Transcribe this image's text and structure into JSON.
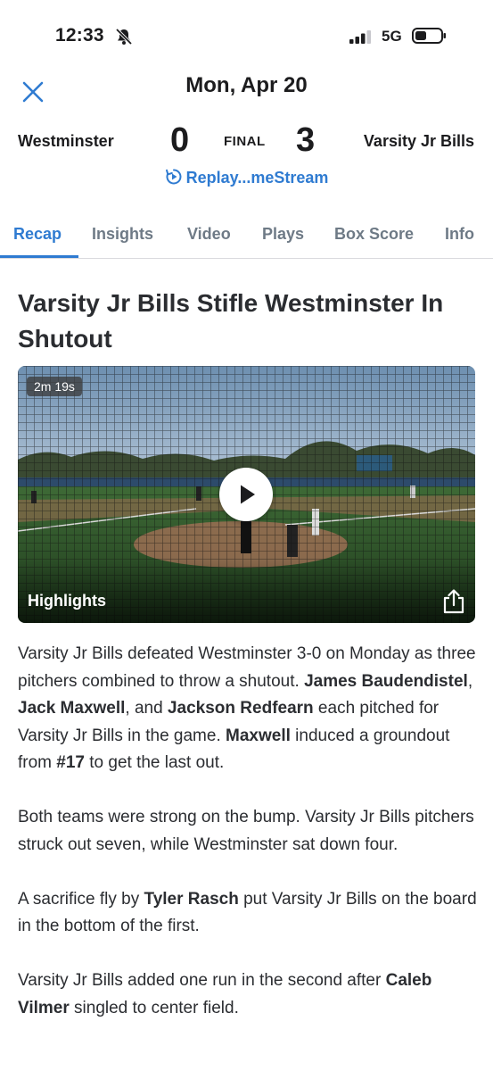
{
  "status_bar": {
    "time": "12:33",
    "network": "5G",
    "icons": [
      "bell-slash-icon",
      "signal-icon",
      "battery-icon"
    ]
  },
  "header": {
    "date_title": "Mon, Apr 20",
    "home_team": "Westminster",
    "away_team": "Varsity Jr Bills",
    "home_score": "0",
    "away_score": "3",
    "game_status": "FINAL",
    "replay_label": "Replay...meStream"
  },
  "tabs": [
    {
      "label": "Recap",
      "active": true
    },
    {
      "label": "Insights",
      "active": false
    },
    {
      "label": "Video",
      "active": false
    },
    {
      "label": "Plays",
      "active": false
    },
    {
      "label": "Box Score",
      "active": false
    },
    {
      "label": "Info",
      "active": false
    }
  ],
  "article": {
    "headline": "Varsity Jr Bills Stifle Westminster In Shutout",
    "video": {
      "duration": "2m 19s",
      "label": "Highlights"
    },
    "paragraphs": [
      [
        {
          "t": "Varsity Jr Bills defeated Westminster 3-0 on Monday as three pitchers combined to throw a shutout. ",
          "b": false
        },
        {
          "t": "James Baudendistel",
          "b": true
        },
        {
          "t": ", ",
          "b": false
        },
        {
          "t": "Jack Maxwell",
          "b": true
        },
        {
          "t": ", and ",
          "b": false
        },
        {
          "t": "Jackson Redfearn",
          "b": true
        },
        {
          "t": " each pitched for Varsity Jr Bills in the game. ",
          "b": false
        },
        {
          "t": "Maxwell",
          "b": true
        },
        {
          "t": " induced a groundout from ",
          "b": false
        },
        {
          "t": "#17",
          "b": true
        },
        {
          "t": " to get the last out.",
          "b": false
        }
      ],
      [
        {
          "t": "Both teams were strong on the bump. Varsity Jr Bills pitchers struck out seven, while Westminster sat down four.",
          "b": false
        }
      ],
      [
        {
          "t": "A sacrifice fly by ",
          "b": false
        },
        {
          "t": "Tyler Rasch",
          "b": true
        },
        {
          "t": " put Varsity Jr Bills on the board in the bottom of the first.",
          "b": false
        }
      ],
      [
        {
          "t": "Varsity Jr Bills added one run in the second after ",
          "b": false
        },
        {
          "t": "Caleb Vilmer",
          "b": true
        },
        {
          "t": " singled to center field.",
          "b": false
        }
      ]
    ]
  },
  "colors": {
    "accent": "#2f7bd1",
    "tab_inactive": "#6e7a86",
    "text": "#2b2d31"
  }
}
